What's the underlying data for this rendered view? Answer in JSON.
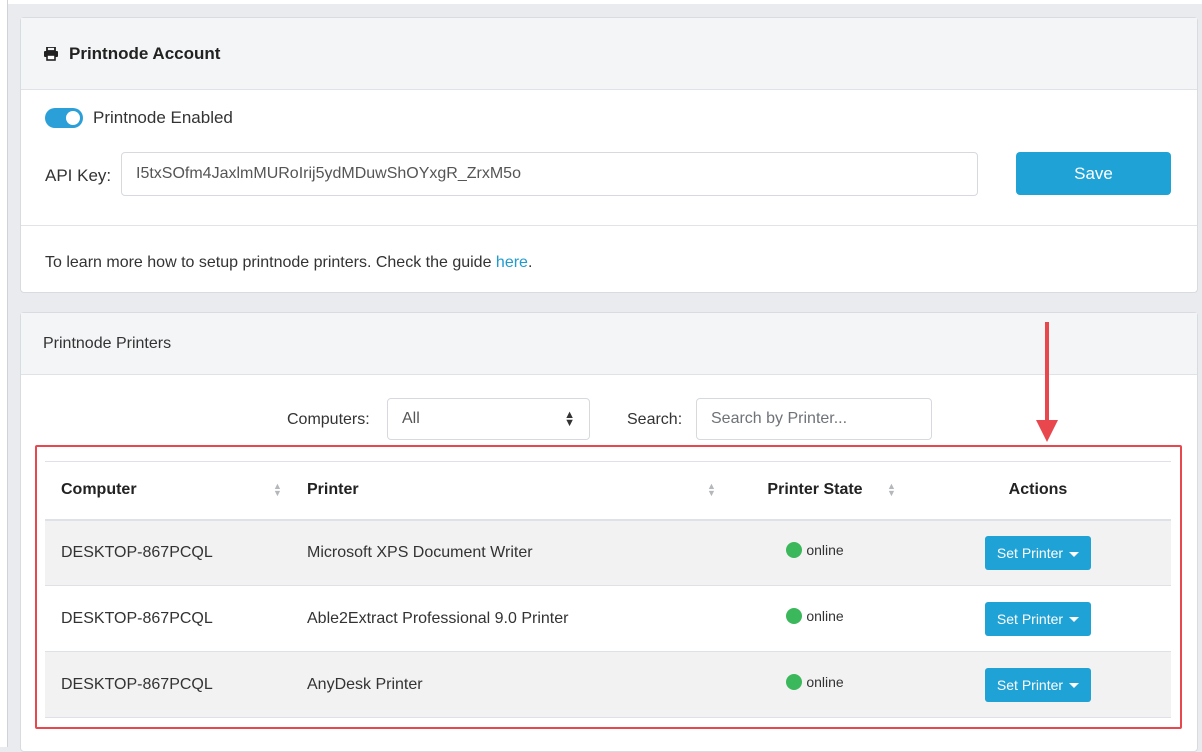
{
  "account": {
    "title": "Printnode Account",
    "enabled_label": "Printnode Enabled",
    "api_key_label": "API Key:",
    "api_key_value": "I5txSOfm4JaxlmMURoIrij5ydMDuwShOYxgR_ZrxM5o",
    "save_label": "Save",
    "guide_text": "To learn more how to setup printnode printers. Check the guide ",
    "guide_link": "here",
    "guide_end": "."
  },
  "printers": {
    "title": "Printnode Printers",
    "computers_label": "Computers:",
    "computers_selected": "All",
    "search_label": "Search:",
    "search_placeholder": "Search by Printer...",
    "columns": {
      "computer": "Computer",
      "printer": "Printer",
      "state": "Printer State",
      "actions": "Actions"
    },
    "rows": [
      {
        "computer": "DESKTOP-867PCQL",
        "printer": "Microsoft XPS Document Writer",
        "state": "online",
        "action": "Set Printer"
      },
      {
        "computer": "DESKTOP-867PCQL",
        "printer": "Able2Extract Professional 9.0 Printer",
        "state": "online",
        "action": "Set Printer"
      },
      {
        "computer": "DESKTOP-867PCQL",
        "printer": "AnyDesk Printer",
        "state": "online",
        "action": "Set Printer"
      }
    ]
  },
  "colors": {
    "accent": "#1fa2d5",
    "online": "#3cb85c",
    "annotation": "#e8474d"
  }
}
